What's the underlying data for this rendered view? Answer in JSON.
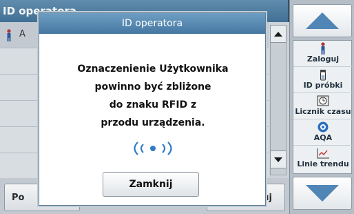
{
  "background": {
    "header_title": "ID operatora",
    "list_row_text": "A",
    "bottom_left_label": "Po",
    "bottom_right_label": "oguj"
  },
  "sidebar": {
    "items": [
      {
        "label": "Zaloguj",
        "icon": "person-icon"
      },
      {
        "label": "ID próbki",
        "icon": "sample-vial-icon"
      },
      {
        "label": "Licznik czasu",
        "icon": "timer-icon"
      },
      {
        "label": "AQA",
        "icon": "aqa-icon"
      },
      {
        "label": "Linie trendu",
        "icon": "trend-chart-icon"
      }
    ]
  },
  "dialog": {
    "title": "ID operatora",
    "message_lines": [
      "Oznaczenienie Użytkownika",
      "powinno być zbliżone",
      "do znaku RFID z",
      "przodu urządzenia."
    ],
    "rfid_symbol": "((•))",
    "close_label": "Zamknij"
  },
  "colors": {
    "header": "#4577a2",
    "accent_arrow": "#4f86b5",
    "rfid": "#2f7cc4"
  }
}
